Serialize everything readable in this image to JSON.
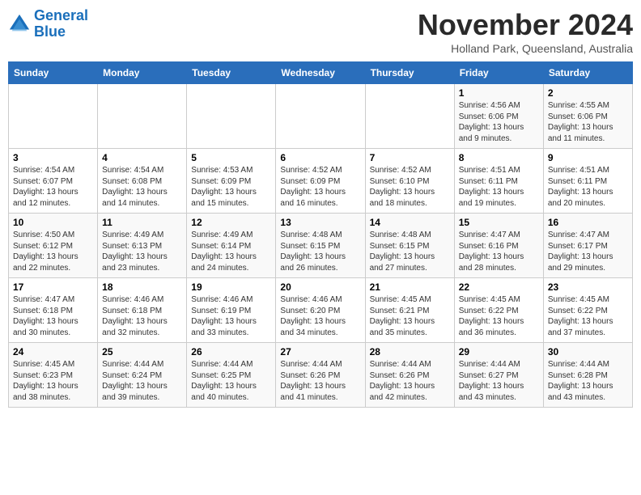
{
  "header": {
    "logo_line1": "General",
    "logo_line2": "Blue",
    "month_title": "November 2024",
    "location": "Holland Park, Queensland, Australia"
  },
  "weekdays": [
    "Sunday",
    "Monday",
    "Tuesday",
    "Wednesday",
    "Thursday",
    "Friday",
    "Saturday"
  ],
  "weeks": [
    [
      {
        "day": "",
        "info": ""
      },
      {
        "day": "",
        "info": ""
      },
      {
        "day": "",
        "info": ""
      },
      {
        "day": "",
        "info": ""
      },
      {
        "day": "",
        "info": ""
      },
      {
        "day": "1",
        "info": "Sunrise: 4:56 AM\nSunset: 6:06 PM\nDaylight: 13 hours and 9 minutes."
      },
      {
        "day": "2",
        "info": "Sunrise: 4:55 AM\nSunset: 6:06 PM\nDaylight: 13 hours and 11 minutes."
      }
    ],
    [
      {
        "day": "3",
        "info": "Sunrise: 4:54 AM\nSunset: 6:07 PM\nDaylight: 13 hours and 12 minutes."
      },
      {
        "day": "4",
        "info": "Sunrise: 4:54 AM\nSunset: 6:08 PM\nDaylight: 13 hours and 14 minutes."
      },
      {
        "day": "5",
        "info": "Sunrise: 4:53 AM\nSunset: 6:09 PM\nDaylight: 13 hours and 15 minutes."
      },
      {
        "day": "6",
        "info": "Sunrise: 4:52 AM\nSunset: 6:09 PM\nDaylight: 13 hours and 16 minutes."
      },
      {
        "day": "7",
        "info": "Sunrise: 4:52 AM\nSunset: 6:10 PM\nDaylight: 13 hours and 18 minutes."
      },
      {
        "day": "8",
        "info": "Sunrise: 4:51 AM\nSunset: 6:11 PM\nDaylight: 13 hours and 19 minutes."
      },
      {
        "day": "9",
        "info": "Sunrise: 4:51 AM\nSunset: 6:11 PM\nDaylight: 13 hours and 20 minutes."
      }
    ],
    [
      {
        "day": "10",
        "info": "Sunrise: 4:50 AM\nSunset: 6:12 PM\nDaylight: 13 hours and 22 minutes."
      },
      {
        "day": "11",
        "info": "Sunrise: 4:49 AM\nSunset: 6:13 PM\nDaylight: 13 hours and 23 minutes."
      },
      {
        "day": "12",
        "info": "Sunrise: 4:49 AM\nSunset: 6:14 PM\nDaylight: 13 hours and 24 minutes."
      },
      {
        "day": "13",
        "info": "Sunrise: 4:48 AM\nSunset: 6:15 PM\nDaylight: 13 hours and 26 minutes."
      },
      {
        "day": "14",
        "info": "Sunrise: 4:48 AM\nSunset: 6:15 PM\nDaylight: 13 hours and 27 minutes."
      },
      {
        "day": "15",
        "info": "Sunrise: 4:47 AM\nSunset: 6:16 PM\nDaylight: 13 hours and 28 minutes."
      },
      {
        "day": "16",
        "info": "Sunrise: 4:47 AM\nSunset: 6:17 PM\nDaylight: 13 hours and 29 minutes."
      }
    ],
    [
      {
        "day": "17",
        "info": "Sunrise: 4:47 AM\nSunset: 6:18 PM\nDaylight: 13 hours and 30 minutes."
      },
      {
        "day": "18",
        "info": "Sunrise: 4:46 AM\nSunset: 6:18 PM\nDaylight: 13 hours and 32 minutes."
      },
      {
        "day": "19",
        "info": "Sunrise: 4:46 AM\nSunset: 6:19 PM\nDaylight: 13 hours and 33 minutes."
      },
      {
        "day": "20",
        "info": "Sunrise: 4:46 AM\nSunset: 6:20 PM\nDaylight: 13 hours and 34 minutes."
      },
      {
        "day": "21",
        "info": "Sunrise: 4:45 AM\nSunset: 6:21 PM\nDaylight: 13 hours and 35 minutes."
      },
      {
        "day": "22",
        "info": "Sunrise: 4:45 AM\nSunset: 6:22 PM\nDaylight: 13 hours and 36 minutes."
      },
      {
        "day": "23",
        "info": "Sunrise: 4:45 AM\nSunset: 6:22 PM\nDaylight: 13 hours and 37 minutes."
      }
    ],
    [
      {
        "day": "24",
        "info": "Sunrise: 4:45 AM\nSunset: 6:23 PM\nDaylight: 13 hours and 38 minutes."
      },
      {
        "day": "25",
        "info": "Sunrise: 4:44 AM\nSunset: 6:24 PM\nDaylight: 13 hours and 39 minutes."
      },
      {
        "day": "26",
        "info": "Sunrise: 4:44 AM\nSunset: 6:25 PM\nDaylight: 13 hours and 40 minutes."
      },
      {
        "day": "27",
        "info": "Sunrise: 4:44 AM\nSunset: 6:26 PM\nDaylight: 13 hours and 41 minutes."
      },
      {
        "day": "28",
        "info": "Sunrise: 4:44 AM\nSunset: 6:26 PM\nDaylight: 13 hours and 42 minutes."
      },
      {
        "day": "29",
        "info": "Sunrise: 4:44 AM\nSunset: 6:27 PM\nDaylight: 13 hours and 43 minutes."
      },
      {
        "day": "30",
        "info": "Sunrise: 4:44 AM\nSunset: 6:28 PM\nDaylight: 13 hours and 43 minutes."
      }
    ]
  ]
}
